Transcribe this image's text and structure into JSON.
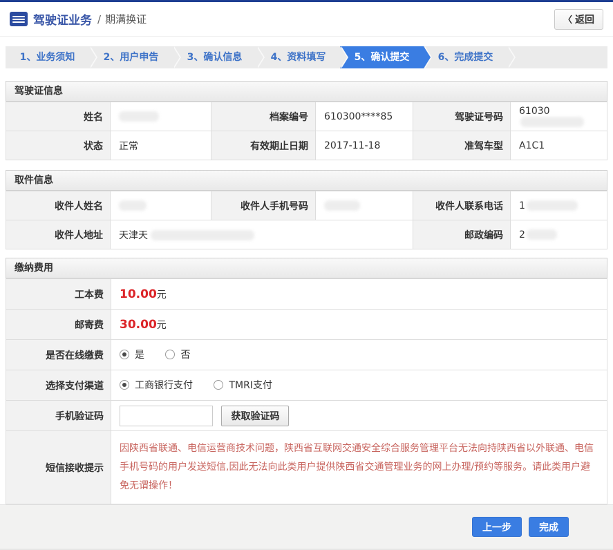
{
  "header": {
    "title": "驾驶证业务",
    "separator": "/",
    "subtitle": "期满换证",
    "back_chevron": "〈",
    "back_label": "返回"
  },
  "steps": {
    "active_label": "5、确认提交",
    "items": [
      {
        "label": "1、业务须知"
      },
      {
        "label": "2、用户申告"
      },
      {
        "label": "3、确认信息"
      },
      {
        "label": "4、资料填写"
      },
      {
        "label": "5、确认提交"
      },
      {
        "label": "6、完成提交"
      }
    ]
  },
  "license_info": {
    "section_title": "驾驶证信息",
    "name_label": "姓名",
    "file_no_label": "档案编号",
    "file_no_value": "610300****85",
    "license_no_label": "驾驶证号码",
    "license_no_value": "61030",
    "status_label": "状态",
    "status_value": "正常",
    "expiry_label": "有效期止日期",
    "expiry_value": "2017-11-18",
    "vehicle_class_label": "准驾车型",
    "vehicle_class_value": "A1C1"
  },
  "pickup_info": {
    "section_title": "取件信息",
    "recipient_name_label": "收件人姓名",
    "recipient_mobile_label": "收件人手机号码",
    "recipient_phone_label": "收件人联系电话",
    "recipient_phone_value": "1",
    "recipient_address_label": "收件人地址",
    "recipient_address_value": "天津天",
    "postal_code_label": "邮政编码",
    "postal_code_value": "2"
  },
  "payment": {
    "section_title": "缴纳费用",
    "fee_label": "工本费",
    "fee_amount": "10.00",
    "fee_unit": "元",
    "postage_label": "邮寄费",
    "postage_amount": "30.00",
    "postage_unit": "元",
    "online_pay_label": "是否在线缴费",
    "online_pay_yes": "是",
    "online_pay_no": "否",
    "online_pay_selected": "是",
    "channel_label": "选择支付渠道",
    "channel_icbc": "工商银行支付",
    "channel_tmri": "TMRI支付",
    "channel_selected": "工商银行支付",
    "sms_code_label": "手机验证码",
    "sms_code_value": "",
    "get_code_label": "获取验证码",
    "sms_tip_label": "短信接收提示",
    "sms_tip_text": "因陕西省联通、电信运营商技术问题，陕西省互联网交通安全综合服务管理平台无法向持陕西省以外联通、电信手机号码的用户发送短信,因此无法向此类用户提供陕西省交通管理业务的网上办理/预约等服务。请此类用户避免无谓操作！"
  },
  "footer": {
    "prev_label": "上一步",
    "done_label": "完成"
  },
  "colors": {
    "top_bar_blue": "#1e3e92",
    "title_blue": "#3a57a8",
    "tab_text_blue": "#3e73c8",
    "active_tab_blue": "#3a7de2",
    "price_red": "#dc2428",
    "warning_red": "#c8655f"
  }
}
